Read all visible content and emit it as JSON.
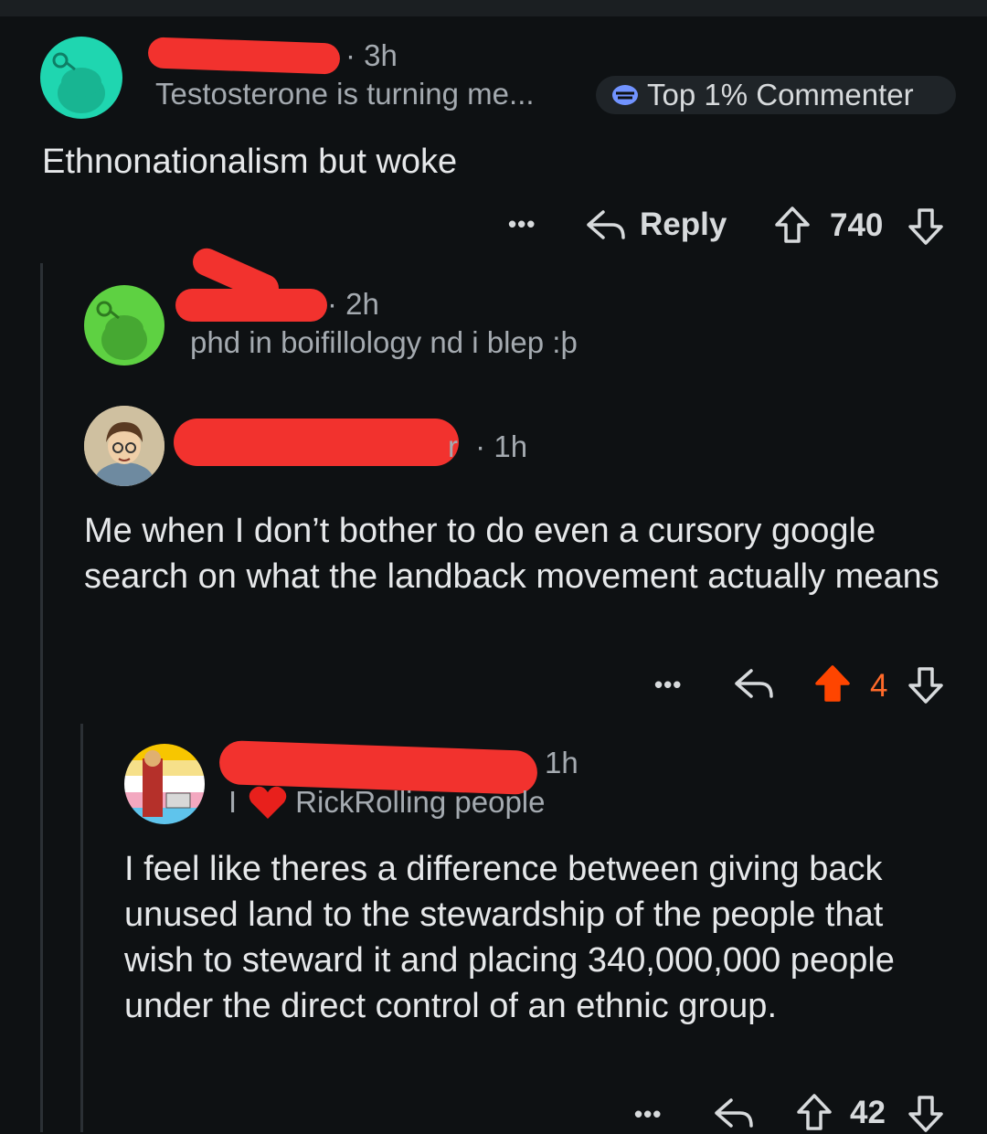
{
  "comments": [
    {
      "time": "3h",
      "user_flair": "Testosterone is turning me...",
      "badge": "Top 1% Commenter",
      "body": "Ethnonationalism but woke",
      "reply_label": "Reply",
      "score": "740",
      "vote_state": "none"
    },
    {
      "time": "2h",
      "user_flair": "phd in boifillology nd i blep :þ"
    },
    {
      "name_fragment": "r",
      "time": "1h",
      "body": "Me when I don’t bother to do even a cursory google search on what the landback movement actually means",
      "score": "4",
      "vote_state": "upvoted"
    },
    {
      "time": "1h",
      "user_flair_prefix": "I",
      "user_flair": "RickRolling people",
      "body": "I feel like theres a difference between giving back unused land to the stewardship of the people that wish to steward it and placing 340,000,000 people under the direct control of an ethnic group.",
      "score": "42",
      "vote_state": "none"
    }
  ],
  "separator": "·",
  "more_label": "•••",
  "colors": {
    "background": "#0e1113",
    "upvote_active": "#ff4500",
    "redaction": "#f2322e",
    "avatar_teal": "#1fd6b0",
    "avatar_green": "#5ed142"
  },
  "icons": [
    "snoo-avatar",
    "upvote-arrow",
    "downvote-arrow",
    "reply-arrow",
    "heart",
    "top-commenter-badge"
  ]
}
